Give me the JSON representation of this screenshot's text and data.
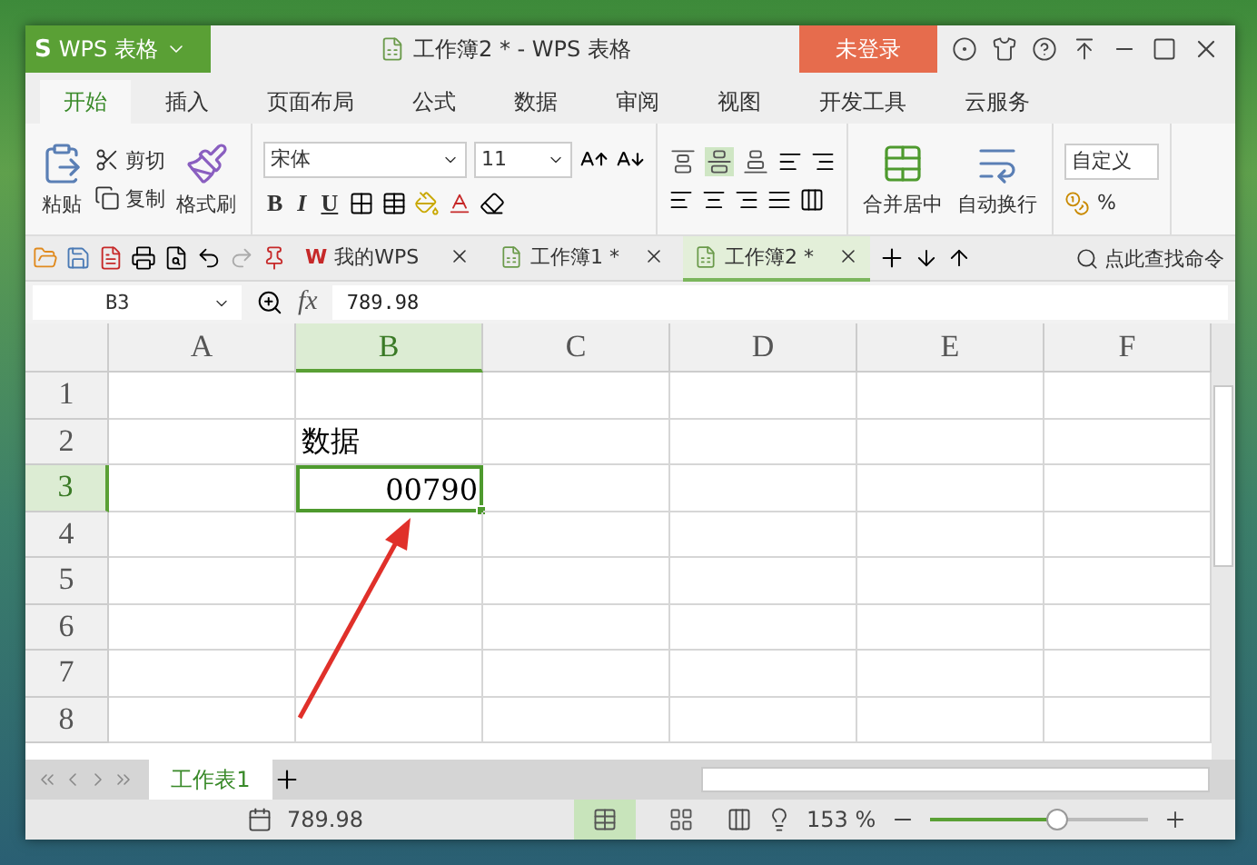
{
  "title_bar": {
    "logo": "S",
    "app_button": "WPS 表格",
    "title": "工作簿2 * - WPS 表格",
    "login_button": "未登录"
  },
  "menu_tabs": [
    {
      "label": "开始",
      "selected": true
    },
    {
      "label": "插入",
      "selected": false
    },
    {
      "label": "页面布局",
      "selected": false
    },
    {
      "label": "公式",
      "selected": false
    },
    {
      "label": "数据",
      "selected": false
    },
    {
      "label": "审阅",
      "selected": false
    },
    {
      "label": "视图",
      "selected": false
    },
    {
      "label": "开发工具",
      "selected": false
    },
    {
      "label": "云服务",
      "selected": false
    }
  ],
  "ribbon": {
    "paste": "粘贴",
    "cut": "剪切",
    "copy": "复制",
    "format_painter": "格式刷",
    "font_name": "宋体",
    "font_size": "11",
    "bold": "B",
    "italic": "I",
    "underline": "U",
    "merge": "合并居中",
    "wrap": "自动换行",
    "number_format": "自定义",
    "percent": "%"
  },
  "vertical_align": [
    {
      "selected": false
    },
    {
      "selected": true
    },
    {
      "selected": false
    }
  ],
  "doc_tabs": [
    {
      "label": "我的WPS",
      "kind": "home",
      "logo": "W",
      "selected": false
    },
    {
      "label": "工作簿1 *",
      "kind": "sheet",
      "selected": false
    },
    {
      "label": "工作簿2 *",
      "kind": "sheet",
      "selected": true
    }
  ],
  "search": {
    "placeholder": "点此查找命令"
  },
  "formula_bar": {
    "cell_ref": "B3",
    "fx": "fx",
    "value": "789.98"
  },
  "grid": {
    "columns": [
      {
        "label": "A",
        "selected": false
      },
      {
        "label": "B",
        "selected": true
      },
      {
        "label": "C",
        "selected": false
      },
      {
        "label": "D",
        "selected": false
      },
      {
        "label": "E",
        "selected": false
      },
      {
        "label": "F",
        "selected": false
      }
    ],
    "rows": [
      {
        "label": "1",
        "selected": false,
        "cells": [
          {
            "selected": false
          },
          {
            "selected": false
          },
          {
            "selected": false
          },
          {
            "selected": false
          },
          {
            "selected": false
          },
          {
            "selected": false
          }
        ]
      },
      {
        "label": "2",
        "selected": false,
        "cells": [
          {
            "selected": false
          },
          {
            "text": "数据",
            "selected": false
          },
          {
            "selected": false
          },
          {
            "selected": false
          },
          {
            "selected": false
          },
          {
            "selected": false
          }
        ]
      },
      {
        "label": "3",
        "selected": true,
        "cells": [
          {
            "selected": false
          },
          {
            "text": "00790",
            "selected": true
          },
          {
            "selected": false
          },
          {
            "selected": false
          },
          {
            "selected": false
          },
          {
            "selected": false
          }
        ]
      },
      {
        "label": "4",
        "selected": false,
        "cells": [
          {
            "selected": false
          },
          {
            "selected": false
          },
          {
            "selected": false
          },
          {
            "selected": false
          },
          {
            "selected": false
          },
          {
            "selected": false
          }
        ]
      },
      {
        "label": "5",
        "selected": false,
        "cells": [
          {
            "selected": false
          },
          {
            "selected": false
          },
          {
            "selected": false
          },
          {
            "selected": false
          },
          {
            "selected": false
          },
          {
            "selected": false
          }
        ]
      },
      {
        "label": "6",
        "selected": false,
        "cells": [
          {
            "selected": false
          },
          {
            "selected": false
          },
          {
            "selected": false
          },
          {
            "selected": false
          },
          {
            "selected": false
          },
          {
            "selected": false
          }
        ]
      },
      {
        "label": "7",
        "selected": false,
        "cells": [
          {
            "selected": false
          },
          {
            "selected": false
          },
          {
            "selected": false
          },
          {
            "selected": false
          },
          {
            "selected": false
          },
          {
            "selected": false
          }
        ]
      },
      {
        "label": "8",
        "selected": false,
        "cells": [
          {
            "selected": false
          },
          {
            "selected": false
          },
          {
            "selected": false
          },
          {
            "selected": false
          },
          {
            "selected": false
          },
          {
            "selected": false
          }
        ]
      }
    ]
  },
  "sheet_tabs": [
    {
      "label": "工作表1",
      "selected": true
    }
  ],
  "status_bar": {
    "value": "789.98",
    "view_buttons": [
      {
        "selected": true
      },
      {
        "selected": false
      }
    ],
    "zoom": "153 %",
    "zoom_slider": {
      "level": 0.58
    }
  }
}
